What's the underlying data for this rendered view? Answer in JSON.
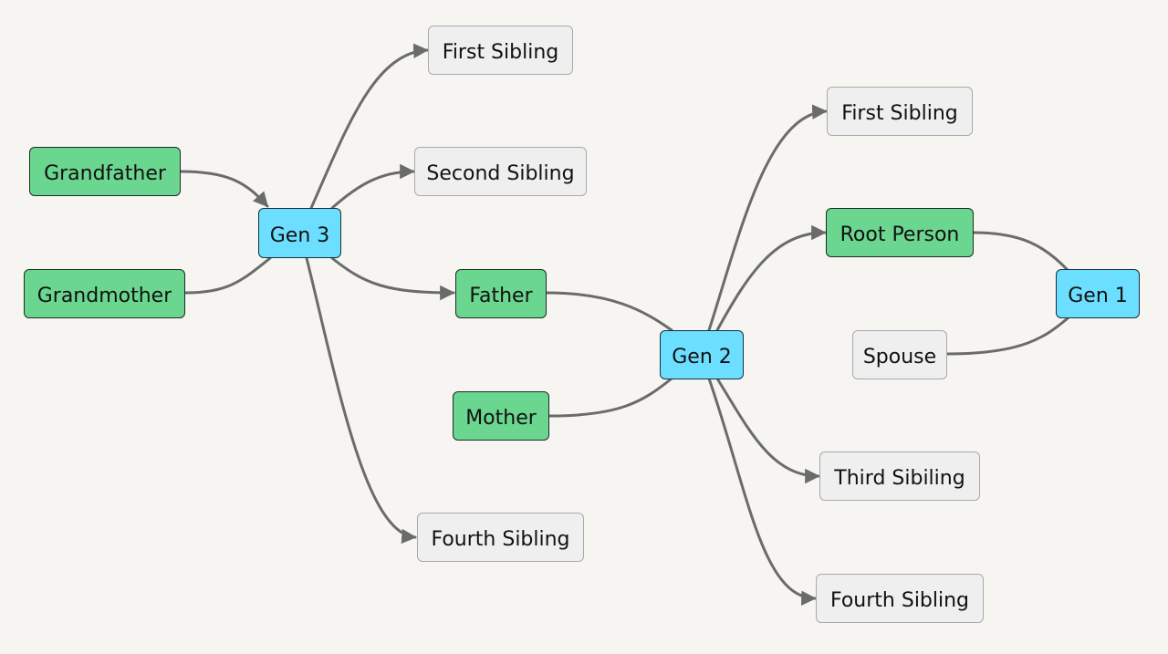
{
  "diagram": {
    "type": "family-tree-flowchart",
    "colors": {
      "background": "#f6f5f2",
      "person_fill": "#6bd68f",
      "generation_fill": "#6cdeff",
      "sibling_fill": "#efefef",
      "edge": "#6b6b6b"
    },
    "nodes": [
      {
        "id": "grandfather",
        "label": "Grandfather",
        "kind": "person"
      },
      {
        "id": "grandmother",
        "label": "Grandmother",
        "kind": "person"
      },
      {
        "id": "gen3",
        "label": "Gen 3",
        "kind": "gen"
      },
      {
        "id": "g3_first",
        "label": "First Sibling",
        "kind": "sib"
      },
      {
        "id": "g3_second",
        "label": "Second Sibling",
        "kind": "sib"
      },
      {
        "id": "father",
        "label": "Father",
        "kind": "person"
      },
      {
        "id": "mother",
        "label": "Mother",
        "kind": "person"
      },
      {
        "id": "g3_fourth",
        "label": "Fourth Sibling",
        "kind": "sib"
      },
      {
        "id": "gen2",
        "label": "Gen 2",
        "kind": "gen"
      },
      {
        "id": "g2_first",
        "label": "First Sibling",
        "kind": "sib"
      },
      {
        "id": "root",
        "label": "Root Person",
        "kind": "person"
      },
      {
        "id": "spouse",
        "label": "Spouse",
        "kind": "sib"
      },
      {
        "id": "gen1",
        "label": "Gen 1",
        "kind": "gen"
      },
      {
        "id": "g2_third",
        "label": "Third Sibiling",
        "kind": "sib"
      },
      {
        "id": "g2_fourth",
        "label": "Fourth Sibling",
        "kind": "sib"
      }
    ],
    "edges": [
      {
        "from": "grandfather",
        "to": "gen3",
        "arrow": true
      },
      {
        "from": "grandmother",
        "to": "gen3",
        "arrow": false
      },
      {
        "from": "gen3",
        "to": "g3_first",
        "arrow": true
      },
      {
        "from": "gen3",
        "to": "g3_second",
        "arrow": true
      },
      {
        "from": "gen3",
        "to": "father",
        "arrow": true
      },
      {
        "from": "gen3",
        "to": "g3_fourth",
        "arrow": true
      },
      {
        "from": "father",
        "to": "gen2",
        "arrow": false
      },
      {
        "from": "mother",
        "to": "gen2",
        "arrow": false
      },
      {
        "from": "gen2",
        "to": "g2_first",
        "arrow": true
      },
      {
        "from": "gen2",
        "to": "root",
        "arrow": true
      },
      {
        "from": "gen2",
        "to": "g2_third",
        "arrow": true
      },
      {
        "from": "gen2",
        "to": "g2_fourth",
        "arrow": true
      },
      {
        "from": "root",
        "to": "gen1",
        "arrow": false
      },
      {
        "from": "spouse",
        "to": "gen1",
        "arrow": false
      }
    ]
  }
}
